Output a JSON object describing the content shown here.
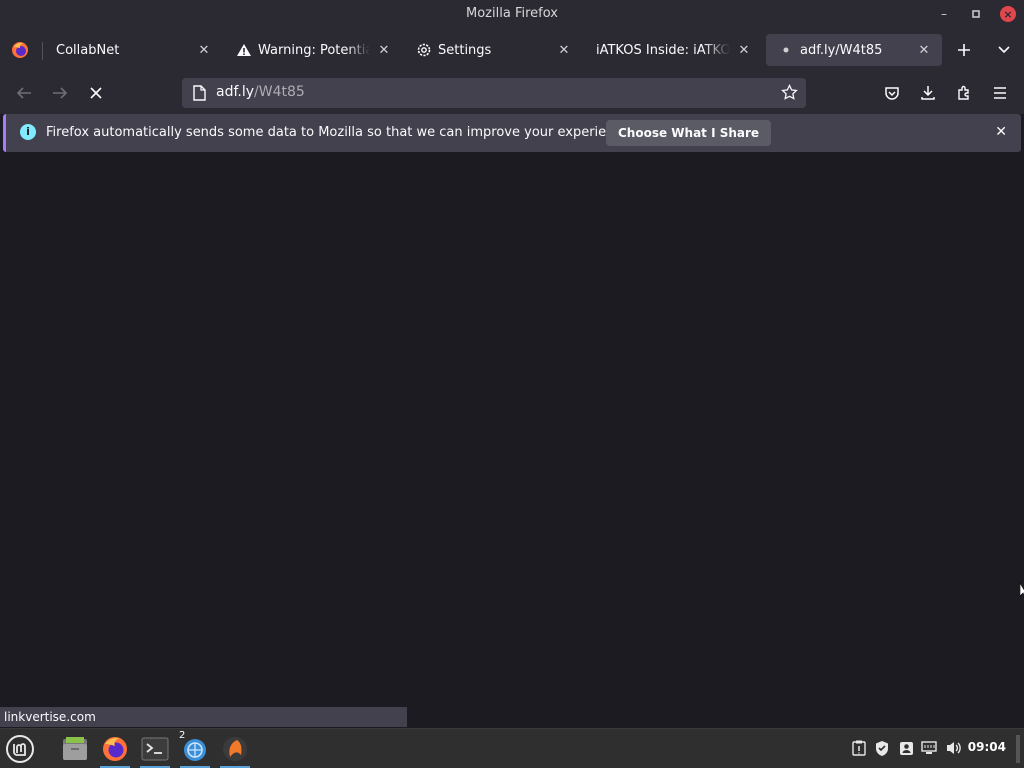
{
  "window": {
    "title": "Mozilla Firefox"
  },
  "tabs": [
    {
      "label": "CollabNet",
      "icon": "none"
    },
    {
      "label": "Warning: Potential Security Risk Ahead",
      "icon": "warning-icon"
    },
    {
      "label": "Settings",
      "icon": "gear-icon"
    },
    {
      "label": "iATKOS Inside: iATKOS M",
      "icon": "none"
    },
    {
      "label": "adf.ly/W4t85",
      "icon": "loading-dot",
      "active": true
    }
  ],
  "toolbar": {
    "url_host": "adf.ly",
    "url_path": "/W4t85"
  },
  "infobar": {
    "message": "Firefox automatically sends some data to Mozilla so that we can improve your experience.",
    "button_label": "Choose What I Share"
  },
  "statusbar": {
    "text": "linkvertise.com"
  },
  "taskbar": {
    "workspace_badge": "2",
    "clock": "09:04"
  },
  "colors": {
    "accent": "#a77bff",
    "info": "#80ebff",
    "chrome": "#2b2a33",
    "content": "#1c1b22"
  }
}
